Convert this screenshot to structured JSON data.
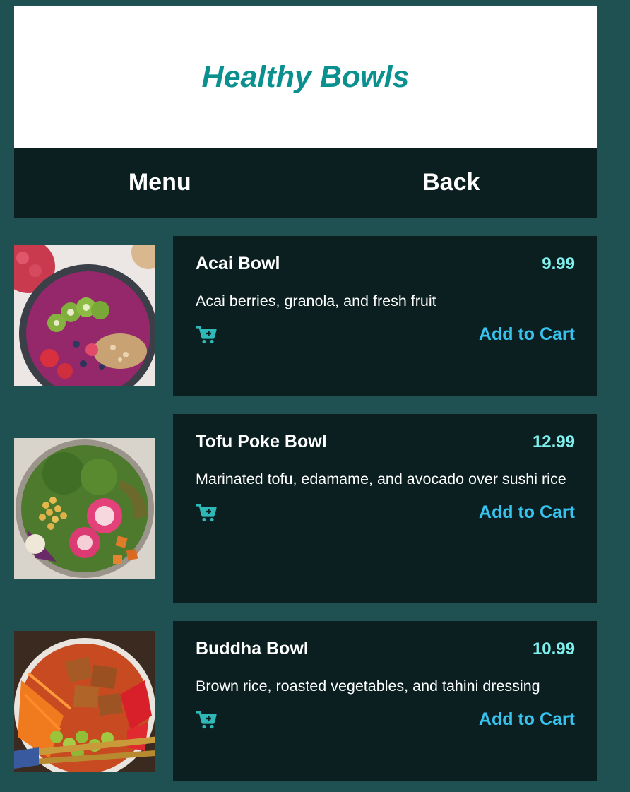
{
  "header": {
    "title": "Healthy Bowls"
  },
  "nav": {
    "menu_label": "Menu",
    "back_label": "Back"
  },
  "products": [
    {
      "name": "Acai Bowl",
      "price": "9.99",
      "description": "Acai berries, granola, and fresh fruit",
      "add_label": "Add to Cart",
      "icon": "cart-plus-icon"
    },
    {
      "name": "Tofu Poke Bowl",
      "price": "12.99",
      "description": "Marinated tofu, edamame, and avocado over sushi rice",
      "add_label": "Add to Cart",
      "icon": "cart-plus-icon"
    },
    {
      "name": "Buddha Bowl",
      "price": "10.99",
      "description": "Brown rice, roasted vegetables, and tahini dressing",
      "add_label": "Add to Cart",
      "icon": "cart-plus-icon"
    }
  ],
  "colors": {
    "background": "#1f5152",
    "panel": "#0b1f20",
    "title": "#0b9090",
    "price": "#7ff0ee",
    "accent": "#38c3ee",
    "icon": "#2fb8b8"
  }
}
